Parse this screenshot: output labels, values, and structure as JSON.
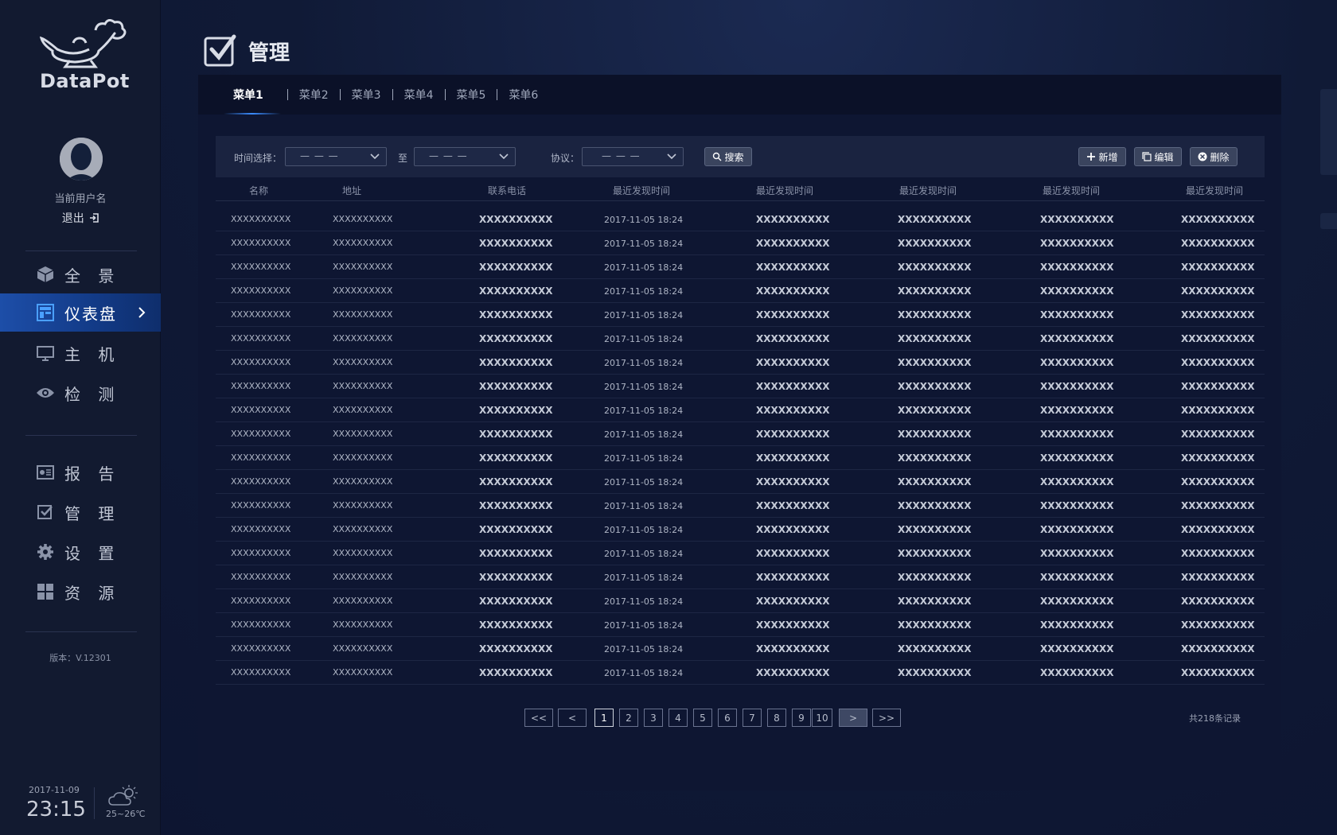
{
  "app": {
    "logo_text": "DataPot",
    "user": {
      "name": "当前用户名",
      "logout": "退出"
    },
    "version": "版本：V.12301",
    "footer": {
      "date": "2017-11-09",
      "time": "23:15",
      "temperature": "25~26℃"
    }
  },
  "sidebar": {
    "items": [
      {
        "label": "全 景",
        "icon": "cube-icon"
      },
      {
        "label": "仪表盘",
        "icon": "dashboard-icon",
        "active": true
      },
      {
        "label": "主 机",
        "icon": "monitor-icon"
      },
      {
        "label": "检 测",
        "icon": "eye-icon"
      },
      {
        "label": "报 告",
        "icon": "report-icon"
      },
      {
        "label": "管 理",
        "icon": "checkbox-icon"
      },
      {
        "label": "设 置",
        "icon": "gear-icon"
      },
      {
        "label": "资 源",
        "icon": "grid-icon"
      }
    ]
  },
  "page": {
    "title": "管理"
  },
  "tabs": [
    "菜单1",
    "菜单2",
    "菜单3",
    "菜单4",
    "菜单5",
    "菜单6"
  ],
  "filters": {
    "time_label": "时间选择：",
    "time_from": "— — —",
    "to_label": "至",
    "time_to": "— — —",
    "protocol_label": "协议：",
    "protocol": "— — —",
    "search": "搜索",
    "add": "新增",
    "edit": "编辑",
    "delete": "删除"
  },
  "table": {
    "columns": [
      "名称",
      "地址",
      "联系电话",
      "最近发现时间",
      "最近发现时间",
      "最近发现时间",
      "最近发现时间",
      "最近发现时间"
    ],
    "rows": [
      [
        "XXXXXXXXXX",
        "XXXXXXXXXX",
        "XXXXXXXXXX",
        "2017-11-05   18:24",
        "XXXXXXXXXX",
        "XXXXXXXXXX",
        "XXXXXXXXXX",
        "XXXXXXXXXX"
      ],
      [
        "XXXXXXXXXX",
        "XXXXXXXXXX",
        "XXXXXXXXXX",
        "2017-11-05   18:24",
        "XXXXXXXXXX",
        "XXXXXXXXXX",
        "XXXXXXXXXX",
        "XXXXXXXXXX"
      ],
      [
        "XXXXXXXXXX",
        "XXXXXXXXXX",
        "XXXXXXXXXX",
        "2017-11-05   18:24",
        "XXXXXXXXXX",
        "XXXXXXXXXX",
        "XXXXXXXXXX",
        "XXXXXXXXXX"
      ],
      [
        "XXXXXXXXXX",
        "XXXXXXXXXX",
        "XXXXXXXXXX",
        "2017-11-05   18:24",
        "XXXXXXXXXX",
        "XXXXXXXXXX",
        "XXXXXXXXXX",
        "XXXXXXXXXX"
      ],
      [
        "XXXXXXXXXX",
        "XXXXXXXXXX",
        "XXXXXXXXXX",
        "2017-11-05   18:24",
        "XXXXXXXXXX",
        "XXXXXXXXXX",
        "XXXXXXXXXX",
        "XXXXXXXXXX"
      ],
      [
        "XXXXXXXXXX",
        "XXXXXXXXXX",
        "XXXXXXXXXX",
        "2017-11-05   18:24",
        "XXXXXXXXXX",
        "XXXXXXXXXX",
        "XXXXXXXXXX",
        "XXXXXXXXXX"
      ],
      [
        "XXXXXXXXXX",
        "XXXXXXXXXX",
        "XXXXXXXXXX",
        "2017-11-05   18:24",
        "XXXXXXXXXX",
        "XXXXXXXXXX",
        "XXXXXXXXXX",
        "XXXXXXXXXX"
      ],
      [
        "XXXXXXXXXX",
        "XXXXXXXXXX",
        "XXXXXXXXXX",
        "2017-11-05   18:24",
        "XXXXXXXXXX",
        "XXXXXXXXXX",
        "XXXXXXXXXX",
        "XXXXXXXXXX"
      ],
      [
        "XXXXXXXXXX",
        "XXXXXXXXXX",
        "XXXXXXXXXX",
        "2017-11-05   18:24",
        "XXXXXXXXXX",
        "XXXXXXXXXX",
        "XXXXXXXXXX",
        "XXXXXXXXXX"
      ],
      [
        "XXXXXXXXXX",
        "XXXXXXXXXX",
        "XXXXXXXXXX",
        "2017-11-05   18:24",
        "XXXXXXXXXX",
        "XXXXXXXXXX",
        "XXXXXXXXXX",
        "XXXXXXXXXX"
      ],
      [
        "XXXXXXXXXX",
        "XXXXXXXXXX",
        "XXXXXXXXXX",
        "2017-11-05   18:24",
        "XXXXXXXXXX",
        "XXXXXXXXXX",
        "XXXXXXXXXX",
        "XXXXXXXXXX"
      ],
      [
        "XXXXXXXXXX",
        "XXXXXXXXXX",
        "XXXXXXXXXX",
        "2017-11-05   18:24",
        "XXXXXXXXXX",
        "XXXXXXXXXX",
        "XXXXXXXXXX",
        "XXXXXXXXXX"
      ],
      [
        "XXXXXXXXXX",
        "XXXXXXXXXX",
        "XXXXXXXXXX",
        "2017-11-05   18:24",
        "XXXXXXXXXX",
        "XXXXXXXXXX",
        "XXXXXXXXXX",
        "XXXXXXXXXX"
      ],
      [
        "XXXXXXXXXX",
        "XXXXXXXXXX",
        "XXXXXXXXXX",
        "2017-11-05   18:24",
        "XXXXXXXXXX",
        "XXXXXXXXXX",
        "XXXXXXXXXX",
        "XXXXXXXXXX"
      ],
      [
        "XXXXXXXXXX",
        "XXXXXXXXXX",
        "XXXXXXXXXX",
        "2017-11-05   18:24",
        "XXXXXXXXXX",
        "XXXXXXXXXX",
        "XXXXXXXXXX",
        "XXXXXXXXXX"
      ],
      [
        "XXXXXXXXXX",
        "XXXXXXXXXX",
        "XXXXXXXXXX",
        "2017-11-05   18:24",
        "XXXXXXXXXX",
        "XXXXXXXXXX",
        "XXXXXXXXXX",
        "XXXXXXXXXX"
      ],
      [
        "XXXXXXXXXX",
        "XXXXXXXXXX",
        "XXXXXXXXXX",
        "2017-11-05   18:24",
        "XXXXXXXXXX",
        "XXXXXXXXXX",
        "XXXXXXXXXX",
        "XXXXXXXXXX"
      ],
      [
        "XXXXXXXXXX",
        "XXXXXXXXXX",
        "XXXXXXXXXX",
        "2017-11-05   18:24",
        "XXXXXXXXXX",
        "XXXXXXXXXX",
        "XXXXXXXXXX",
        "XXXXXXXXXX"
      ],
      [
        "XXXXXXXXXX",
        "XXXXXXXXXX",
        "XXXXXXXXXX",
        "2017-11-05   18:24",
        "XXXXXXXXXX",
        "XXXXXXXXXX",
        "XXXXXXXXXX",
        "XXXXXXXXXX"
      ],
      [
        "XXXXXXXXXX",
        "XXXXXXXXXX",
        "XXXXXXXXXX",
        "2017-11-05   18:24",
        "XXXXXXXXXX",
        "XXXXXXXXXX",
        "XXXXXXXXXX",
        "XXXXXXXXXX"
      ]
    ]
  },
  "pagination": {
    "first": "<<",
    "prev": "<",
    "pages": [
      "1",
      "2",
      "3",
      "4",
      "5",
      "6",
      "7",
      "8",
      "9",
      "10"
    ],
    "current": "1",
    "next": ">",
    "last": ">>",
    "total": "共218条记录"
  },
  "colors": {
    "accent": "#1d4ea8",
    "panel": "#0e1632",
    "sidebar": "#121a30"
  }
}
